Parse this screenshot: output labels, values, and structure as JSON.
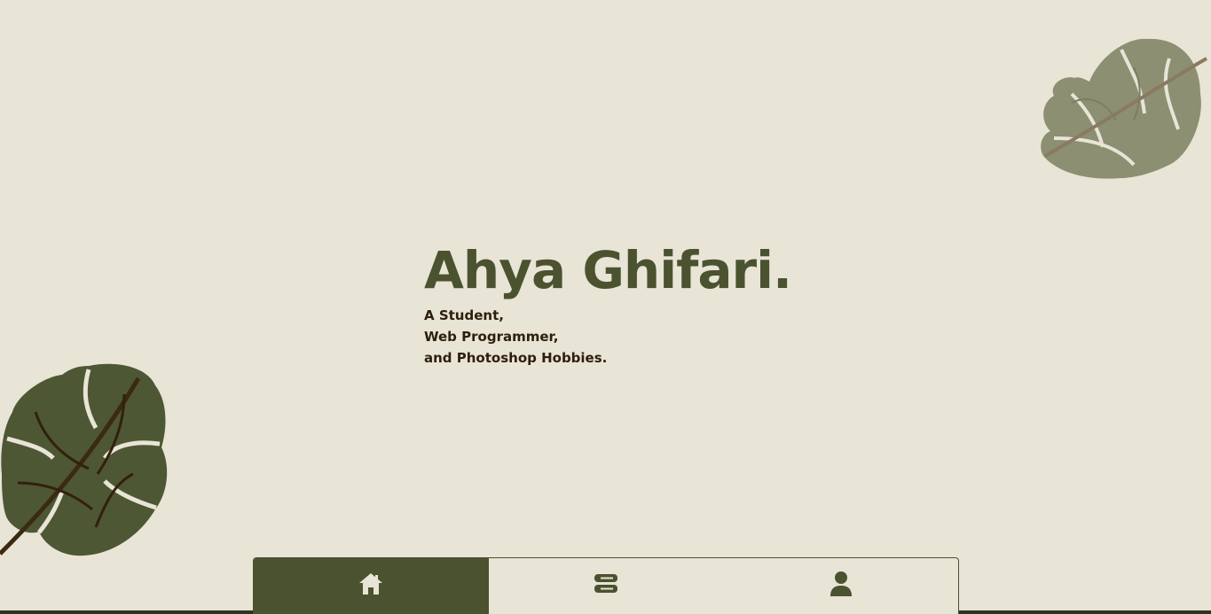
{
  "hero": {
    "name": "Ahya Ghifari.",
    "lines": [
      "A Student,",
      "Web Programmer,",
      "and Photoshop Hobbies."
    ]
  },
  "nav": {
    "items": [
      {
        "icon": "home-icon",
        "active": true
      },
      {
        "icon": "server-icon",
        "active": false
      },
      {
        "icon": "user-icon",
        "active": false
      }
    ]
  },
  "colors": {
    "background": "#e8e4d6",
    "accent": "#4a522f",
    "text_dark": "#2e1e0c",
    "leaf_light": "#8c8f72",
    "leaf_dark": "#4a5a34"
  }
}
